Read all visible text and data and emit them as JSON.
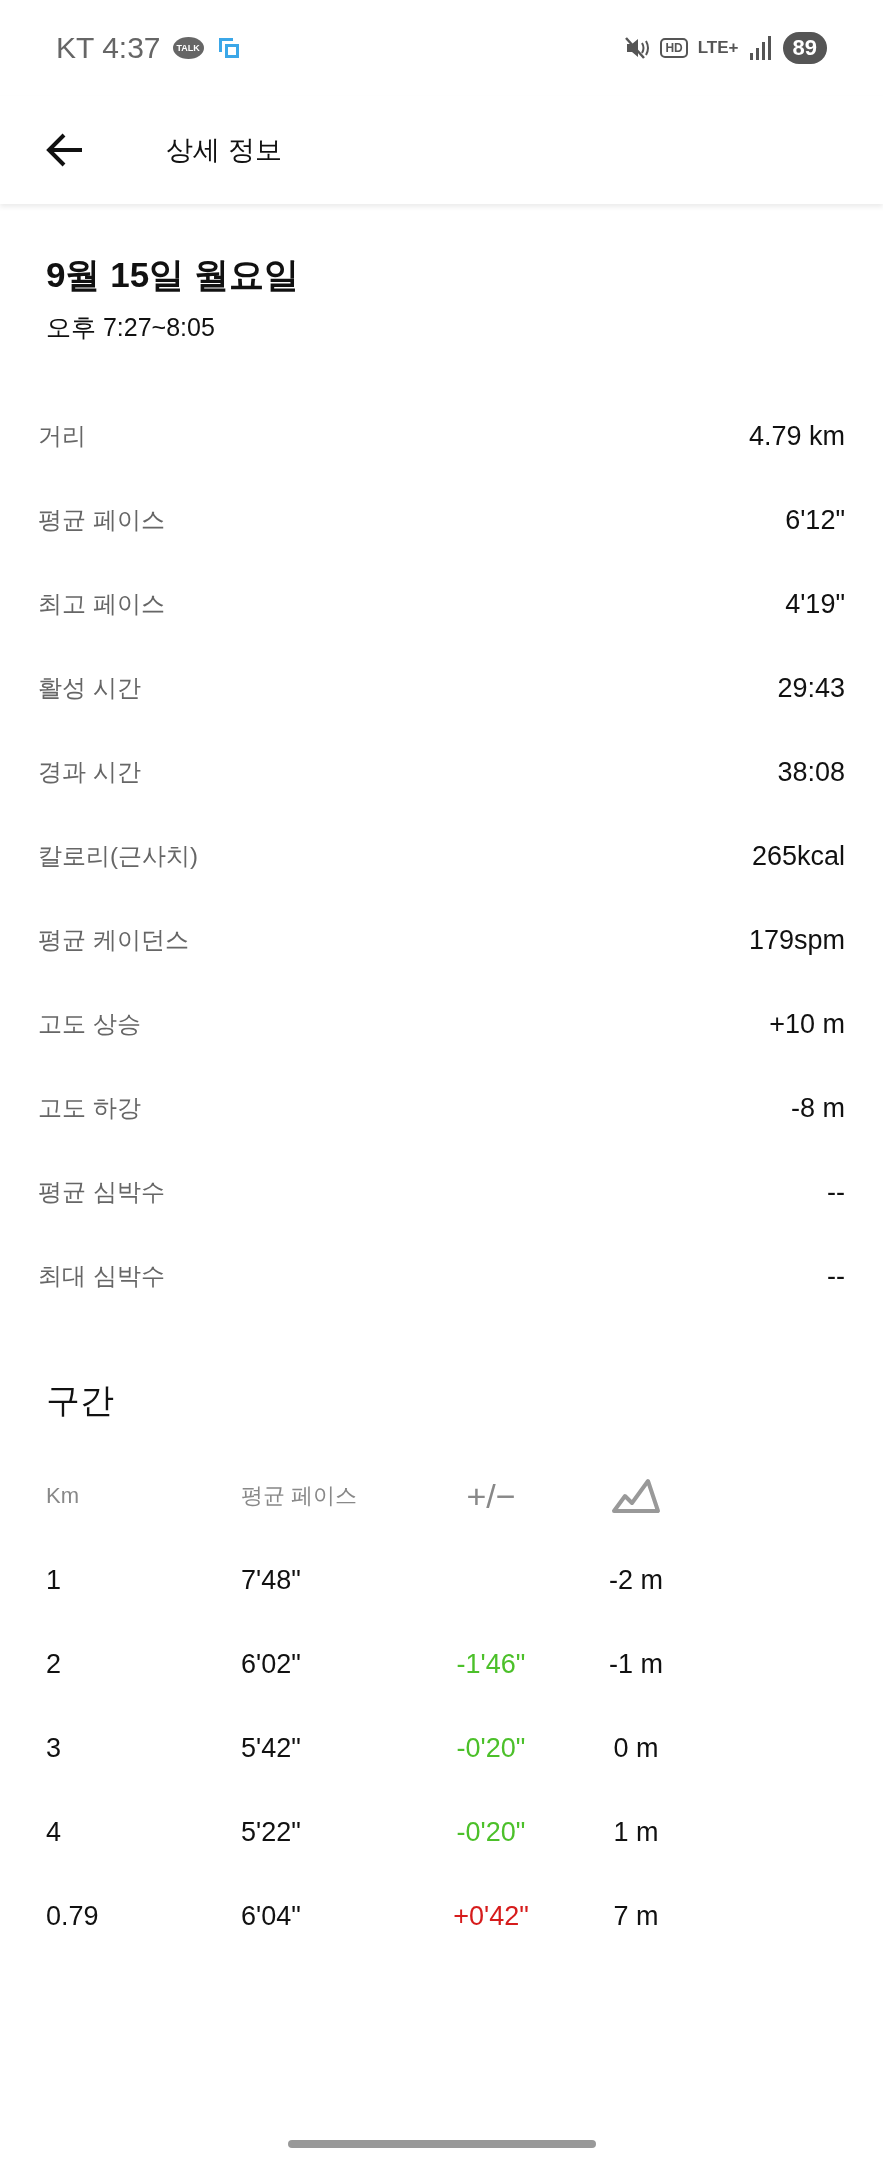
{
  "status_bar": {
    "carrier_time": "KT 4:37",
    "talk_badge": "TALK",
    "hd_badge": "HD",
    "network": "LTE+",
    "battery": "89"
  },
  "header": {
    "title": "상세 정보"
  },
  "date": {
    "title": "9월 15일 월요일",
    "time_range": "오후 7:27~8:05"
  },
  "stats": [
    {
      "label": "거리",
      "value": "4.79 km"
    },
    {
      "label": "평균 페이스",
      "value": "6'12\""
    },
    {
      "label": "최고 페이스",
      "value": "4'19\""
    },
    {
      "label": "활성 시간",
      "value": "29:43"
    },
    {
      "label": "경과 시간",
      "value": "38:08"
    },
    {
      "label": "칼로리(근사치)",
      "value": "265kcal"
    },
    {
      "label": "평균 케이던스",
      "value": "179spm"
    },
    {
      "label": "고도 상승",
      "value": "+10 m"
    },
    {
      "label": "고도 하강",
      "value": "-8 m"
    },
    {
      "label": "평균 심박수",
      "value": "--"
    },
    {
      "label": "최대 심박수",
      "value": "--"
    }
  ],
  "splits": {
    "title": "구간",
    "columns": [
      "Km",
      "평균 페이스",
      "+/−"
    ],
    "rows": [
      {
        "km": "1",
        "pace": "7'48\"",
        "elevation": "-2 m"
      },
      {
        "km": "2",
        "pace": "6'02\"",
        "delta": "-1'46\"",
        "color": "#4cc02a",
        "elevation": "-1 m"
      },
      {
        "km": "3",
        "pace": "5'42\"",
        "delta": "-0'20\"",
        "color": "#4cc02a",
        "elevation": "0 m"
      },
      {
        "km": "4",
        "pace": "5'22\"",
        "delta": "-0'20\"",
        "color": "#4cc02a",
        "elevation": "1 m"
      },
      {
        "km": "0.79",
        "pace": "6'04\"",
        "delta": "+0'42\"",
        "color": "#d61c1c",
        "elevation": "7 m"
      }
    ]
  }
}
